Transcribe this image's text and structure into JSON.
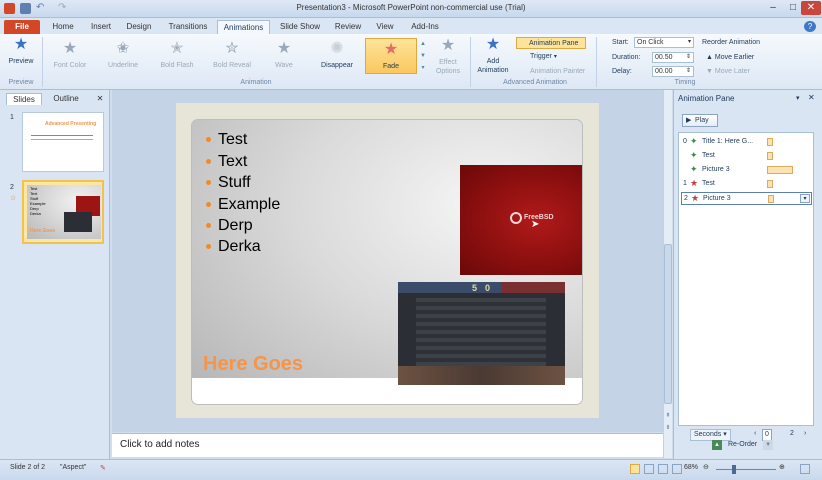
{
  "window": {
    "title": "Presentation3 - Microsoft PowerPoint non-commercial use (Trial)",
    "minimize": "–",
    "restore": "□",
    "close": "✕"
  },
  "tabs": [
    "File",
    "Home",
    "Insert",
    "Design",
    "Transitions",
    "Animations",
    "Slide Show",
    "Review",
    "View",
    "Add-Ins"
  ],
  "ribbon": {
    "preview": {
      "label": "Preview",
      "group": "Preview"
    },
    "animations": [
      {
        "label": "Font Color",
        "icon": "star"
      },
      {
        "label": "Underline",
        "icon": "underline"
      },
      {
        "label": "Bold Flash",
        "icon": "bold-flash"
      },
      {
        "label": "Bold Reveal",
        "icon": "bold-reveal"
      },
      {
        "label": "Wave",
        "icon": "wave"
      },
      {
        "label": "Disappear",
        "icon": "disappear"
      },
      {
        "label": "Fade",
        "icon": "fade"
      }
    ],
    "effect_options": "Effect Options",
    "animation_group": "Animation",
    "add_animation": "Add Animation",
    "animation_pane": "Animation Pane",
    "trigger": "Trigger",
    "animation_painter": "Animation Painter",
    "advanced_group": "Advanced Animation",
    "start_label": "Start:",
    "start_value": "On Click",
    "duration_label": "Duration:",
    "duration_value": "00.50",
    "delay_label": "Delay:",
    "delay_value": "00.00",
    "reorder_title": "Reorder Animation",
    "move_earlier": "Move Earlier",
    "move_later": "Move Later",
    "timing_group": "Timing"
  },
  "leftpane": {
    "tabs": [
      "Slides",
      "Outline"
    ],
    "close": "✕",
    "slides": [
      {
        "num": "1",
        "title": "Advanced Presenting"
      },
      {
        "num": "2",
        "title": "Here Goes",
        "bullets": [
          "Test",
          "Text",
          "Stuff",
          "Example",
          "Derp",
          "Derka"
        ]
      }
    ]
  },
  "slide": {
    "bullets": [
      "Test",
      "Text",
      "Stuff",
      "Example",
      "Derp",
      "Derka"
    ],
    "title": "Here Goes",
    "picture_caption": "FreeBSD",
    "score_left": "5",
    "score_right": "0"
  },
  "notes": {
    "placeholder": "Click to add notes"
  },
  "animation_pane": {
    "title": "Animation Pane",
    "play": "Play",
    "items": [
      {
        "num": "0",
        "name": "Title 1: Here G...",
        "icon": "walk"
      },
      {
        "num": "",
        "name": "Test",
        "icon": "walk"
      },
      {
        "num": "",
        "name": "Picture 3",
        "icon": "walk"
      },
      {
        "num": "1",
        "name": "Test",
        "icon": "star"
      },
      {
        "num": "2",
        "name": "Picture 3",
        "icon": "star"
      }
    ],
    "seconds": "Seconds",
    "sec_start": "0",
    "sec_end": "2",
    "reorder": "Re-Order"
  },
  "status": {
    "slide": "Slide 2 of 2",
    "theme": "\"Aspect\"",
    "zoom": "68%"
  },
  "colors": {
    "accent": "#f4954a",
    "file_tab": "#d24726",
    "selection": "#f2c24f"
  }
}
